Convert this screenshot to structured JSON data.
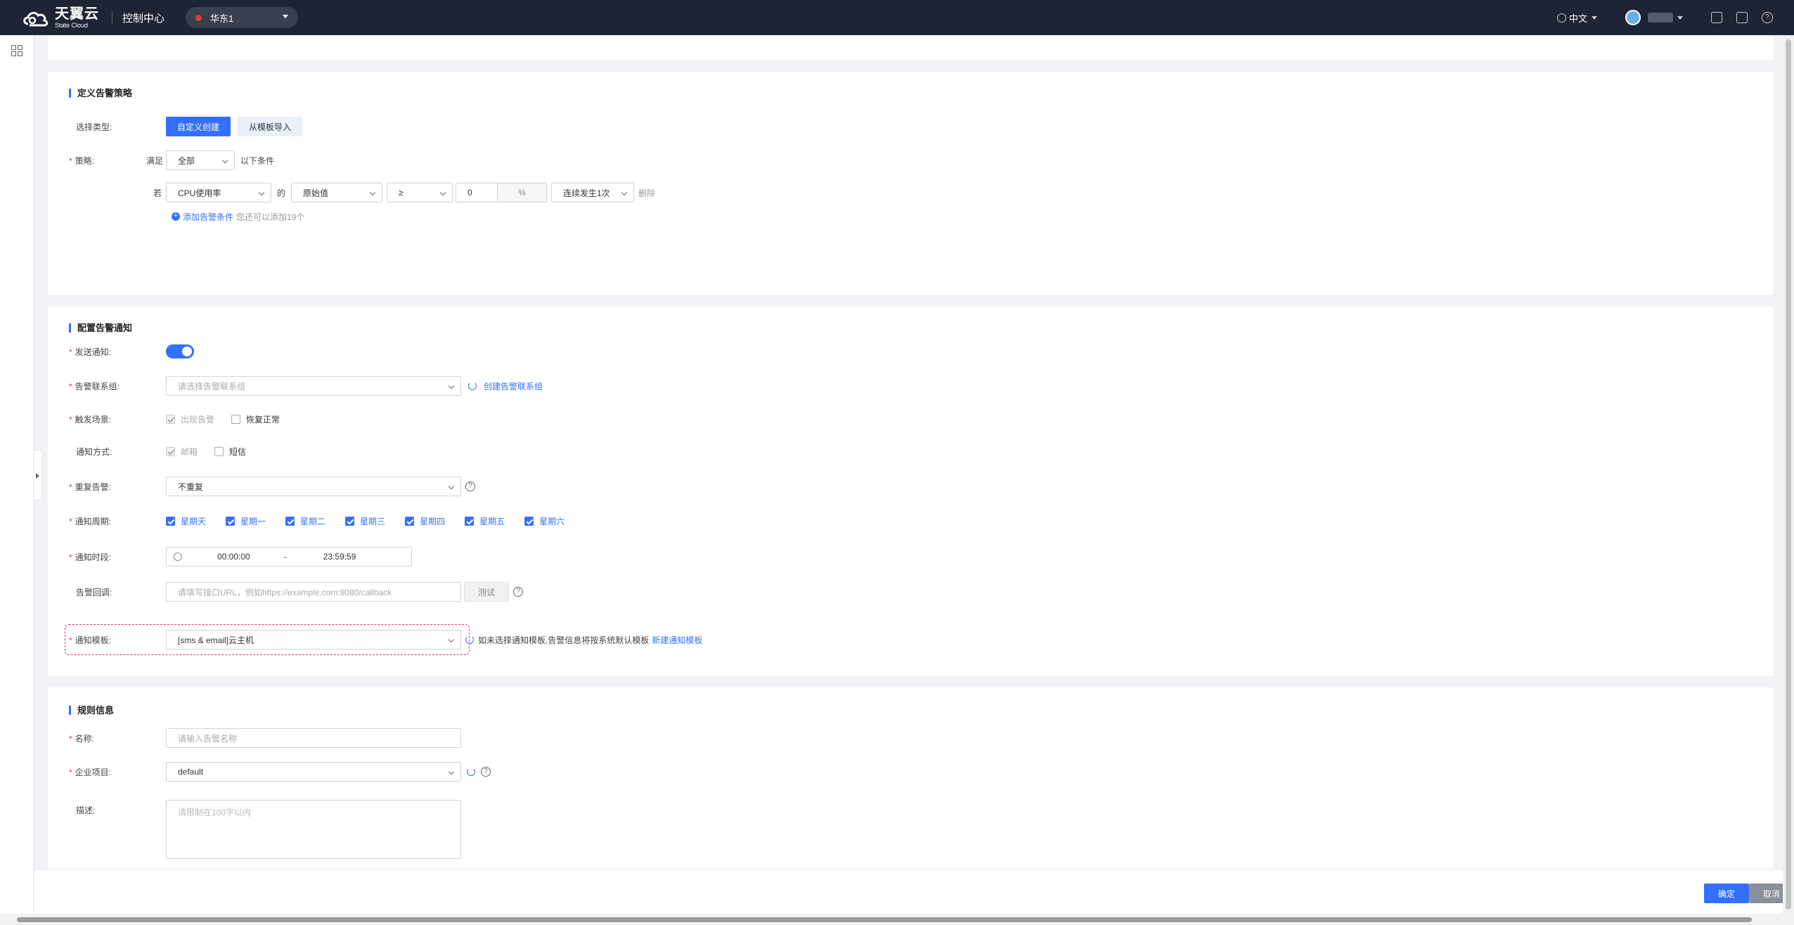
{
  "topbar": {
    "logo_cn": "天翼云",
    "logo_en": "State Cloud",
    "console": "控制中心",
    "region": "华东1",
    "lang": "中文"
  },
  "strategy": {
    "title": "定义告警策略",
    "type_label": "选择类型:",
    "btn_custom": "自定义创建",
    "btn_template": "从模板导入",
    "policy_label": "策略:",
    "satisfy": "满足",
    "all": "全部",
    "conditions_suffix": "以下条件",
    "if": "若",
    "metric": "CPU使用率",
    "of": "的",
    "value_type": "原始值",
    "operator": "≥",
    "threshold": "0",
    "unit": "%",
    "occurrence": "连续发生1次",
    "delete": "删除",
    "add_condition": "添加告警条件",
    "add_hint": "您还可以添加19个"
  },
  "notify": {
    "title": "配置告警通知",
    "send_label": "发送通知:",
    "contact_label": "告警联系组:",
    "contact_placeholder": "请选择告警联系组",
    "create_contact": "创建告警联系组",
    "trigger_label": "触发场景:",
    "trigger_alarm": "出现告警",
    "trigger_recover": "恢复正常",
    "method_label": "通知方式:",
    "method_email": "邮箱",
    "method_sms": "短信",
    "repeat_label": "重复告警:",
    "repeat_value": "不重复",
    "period_label": "通知周期:",
    "weekdays": [
      "星期天",
      "星期一",
      "星期二",
      "星期三",
      "星期四",
      "星期五",
      "星期六"
    ],
    "time_label": "通知时段:",
    "time_start": "00:00:00",
    "time_sep": "-",
    "time_end": "23:59:59",
    "callback_label": "告警回调:",
    "callback_placeholder": "请填写接口URL，例如https://example.com:8080/callback",
    "test": "测试",
    "template_label": "通知模板:",
    "template_value": "[sms & email]云主机",
    "template_hint": "如未选择通知模板,告警信息将按系统默认模板",
    "new_template": "新建通知模板"
  },
  "rule": {
    "title": "规则信息",
    "name_label": "名称:",
    "name_placeholder": "请输入告警名称",
    "project_label": "企业项目:",
    "project_value": "default",
    "desc_label": "描述:",
    "desc_placeholder": "请限制在100字以内"
  },
  "footer": {
    "ok": "确定",
    "cancel": "取消"
  }
}
